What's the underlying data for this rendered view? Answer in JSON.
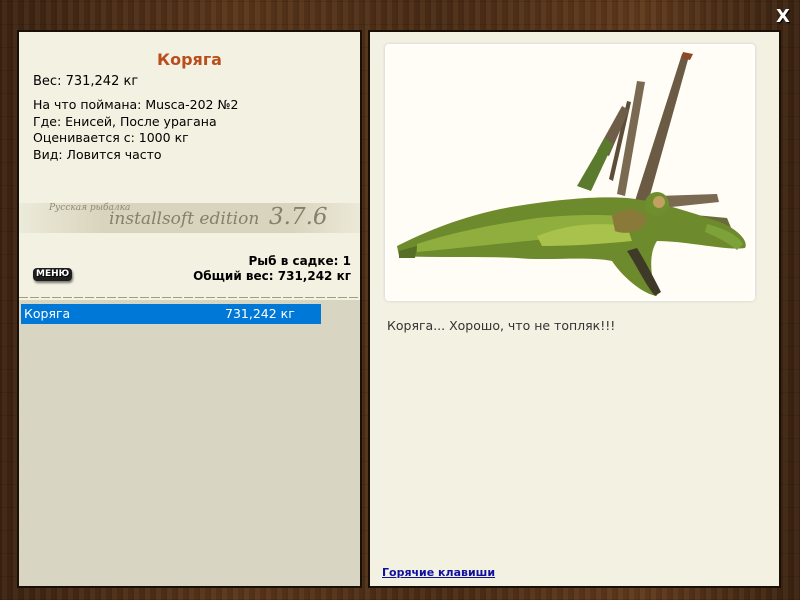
{
  "close_label": "X",
  "fish": {
    "name": "Коряга",
    "weight_line": "Вес: 731,242 кг",
    "caught_with_label": "На что поймана:",
    "caught_with_value": "Musca-202 №2",
    "where_label": "Где:",
    "where_value": "Енисей, После урагана",
    "valued_label": "Оценивается с:",
    "valued_value": "1000 кг",
    "kind_label": "Вид:",
    "kind_value": "Ловится часто",
    "description": "Коряга... Хорошо, что не топляк!!!"
  },
  "banner": {
    "game_name": "Русская рыбалка",
    "edition": "installsoft edition",
    "version": "3.7.6"
  },
  "keepnet": {
    "count_text": "Рыб в садке: 1",
    "total_weight_text": "Общий вес: 731,242 кг"
  },
  "menu_label": "МЕНЮ",
  "fish_list": [
    {
      "name": "Коряга",
      "weight": "731,242 кг"
    }
  ],
  "hotkeys_label": "Горячие клавиши"
}
